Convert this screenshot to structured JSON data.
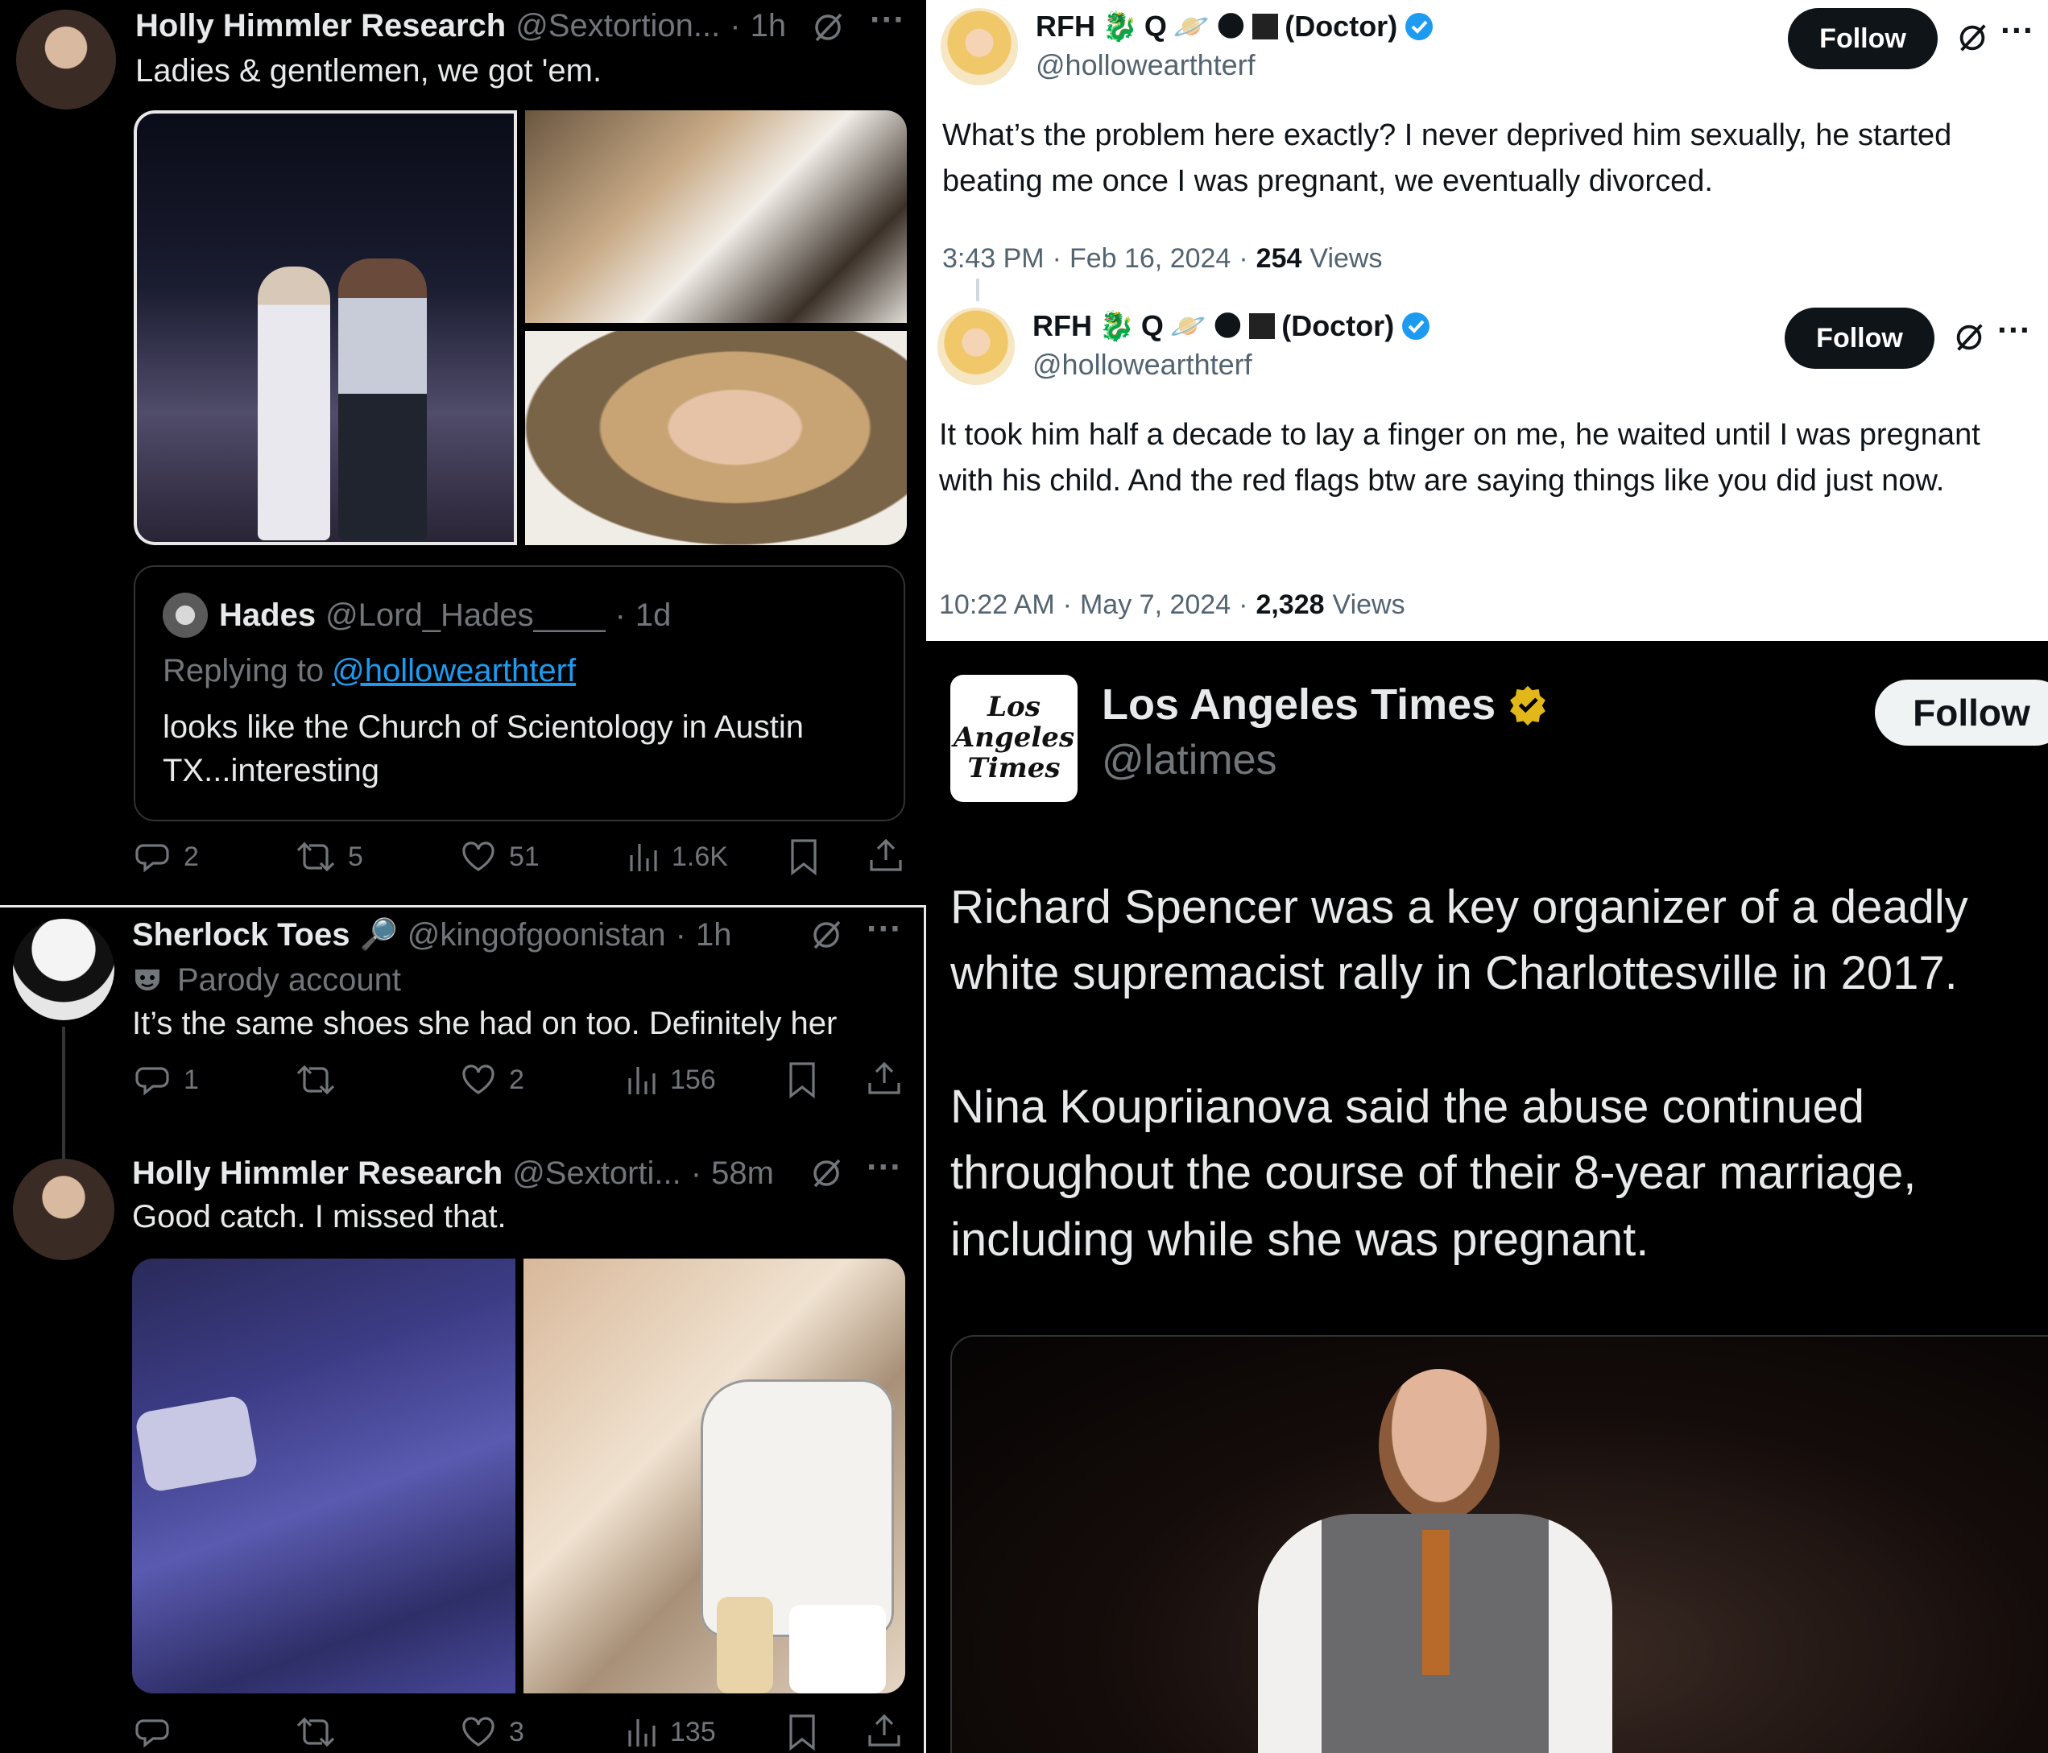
{
  "tl": {
    "author_name": "Holly Himmler Research",
    "handle": "@Sextortion...",
    "time": "1h",
    "text": "Ladies & gentlemen, we got 'em.",
    "quote": {
      "name": "Hades",
      "handle": "@Lord_Hades____",
      "time": "1d",
      "replying_prefix": "Replying to",
      "replying_to": "@hollowearthterf",
      "text": "looks like the Church of Scientology in Austin TX...interesting"
    },
    "stats": {
      "replies": "2",
      "reposts": "5",
      "likes": "51",
      "views": "1.6K"
    }
  },
  "bl": {
    "reply1": {
      "author_name": "Sherlock Toes",
      "handle": "@kingofgoonistan",
      "time": "1h",
      "badge": "Parody account",
      "text": "It’s the same shoes she had on too. Definitely her",
      "stats": {
        "replies": "1",
        "reposts": "",
        "likes": "2",
        "views": "156"
      }
    },
    "reply2": {
      "author_name": "Holly Himmler Research",
      "handle": "@Sextorti...",
      "time": "58m",
      "text": "Good catch. I missed that.",
      "stats": {
        "replies": "",
        "reposts": "",
        "likes": "3",
        "views": "135"
      }
    }
  },
  "tr": {
    "tweet1": {
      "name_prefix": "RFH",
      "name_suffix": "(Doctor)",
      "handle": "@hollowearthterf",
      "follow": "Follow",
      "text": "What’s the problem here exactly? I never deprived him sexually, he started beating me once I was pregnant, we eventually divorced.",
      "time": "3:43 PM",
      "date": "Feb 16, 2024",
      "views_count": "254",
      "views_label": "Views"
    },
    "tweet2": {
      "name_prefix": "RFH",
      "name_suffix": "(Doctor)",
      "handle": "@hollowearthterf",
      "follow": "Follow",
      "text": "It took him half a decade to lay a finger on me, he waited until I was pregnant with his child. And the red flags btw are saying things like you did just now.",
      "time": "10:22 AM",
      "date": "May 7, 2024",
      "views_count": "2,328",
      "views_label": "Views"
    }
  },
  "br": {
    "logo_lines": [
      "Los",
      "Angeles",
      "Times"
    ],
    "name": "Los Angeles Times",
    "handle": "@latimes",
    "follow": "Follow",
    "para1": "Richard Spencer was a key organizer of a deadly white supremacist rally in Charlottesville in 2017.",
    "para2": "Nina Koupriianova said the abuse continued throughout the course of their 8-year marriage, including while she was pregnant."
  },
  "colors": {
    "background_dark": "#000000",
    "background_light": "#ffffff",
    "text_light": "#e7e9ea",
    "text_dark": "#0f1419",
    "muted": "#71767b",
    "link": "#1d9bf0",
    "verified_blue": "#1d9bf0",
    "verified_gold": "#e2b719"
  },
  "icons": [
    "more-icon",
    "grok-icon",
    "reply-icon",
    "repost-icon",
    "like-icon",
    "views-icon",
    "bookmark-icon",
    "share-icon",
    "verified-icon",
    "mask-icon",
    "magnifier-icon"
  ]
}
